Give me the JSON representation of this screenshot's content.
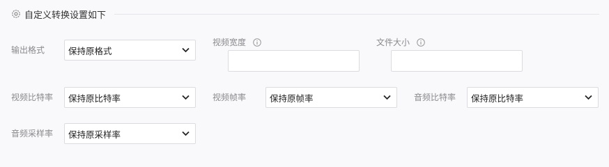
{
  "section": {
    "title": "自定义转换设置如下",
    "icon": "gear-icon"
  },
  "fields": {
    "output_format": {
      "label": "输出格式",
      "value": "保持原格式"
    },
    "video_width": {
      "label": "视频宽度",
      "value": "",
      "icon": "info-icon"
    },
    "file_size": {
      "label": "文件大小",
      "value": "",
      "icon": "info-icon"
    },
    "video_bitrate": {
      "label": "视频比特率",
      "value": "保持原比特率"
    },
    "video_framerate": {
      "label": "视频帧率",
      "value": "保持原帧率"
    },
    "audio_bitrate": {
      "label": "音频比特率",
      "value": "保持原比特率"
    },
    "audio_samplerate": {
      "label": "音频采样率",
      "value": "保持原采样率"
    }
  },
  "colors": {
    "label": "#8a8a8e",
    "border": "#dcdce0",
    "background": "#f9f9fb"
  }
}
